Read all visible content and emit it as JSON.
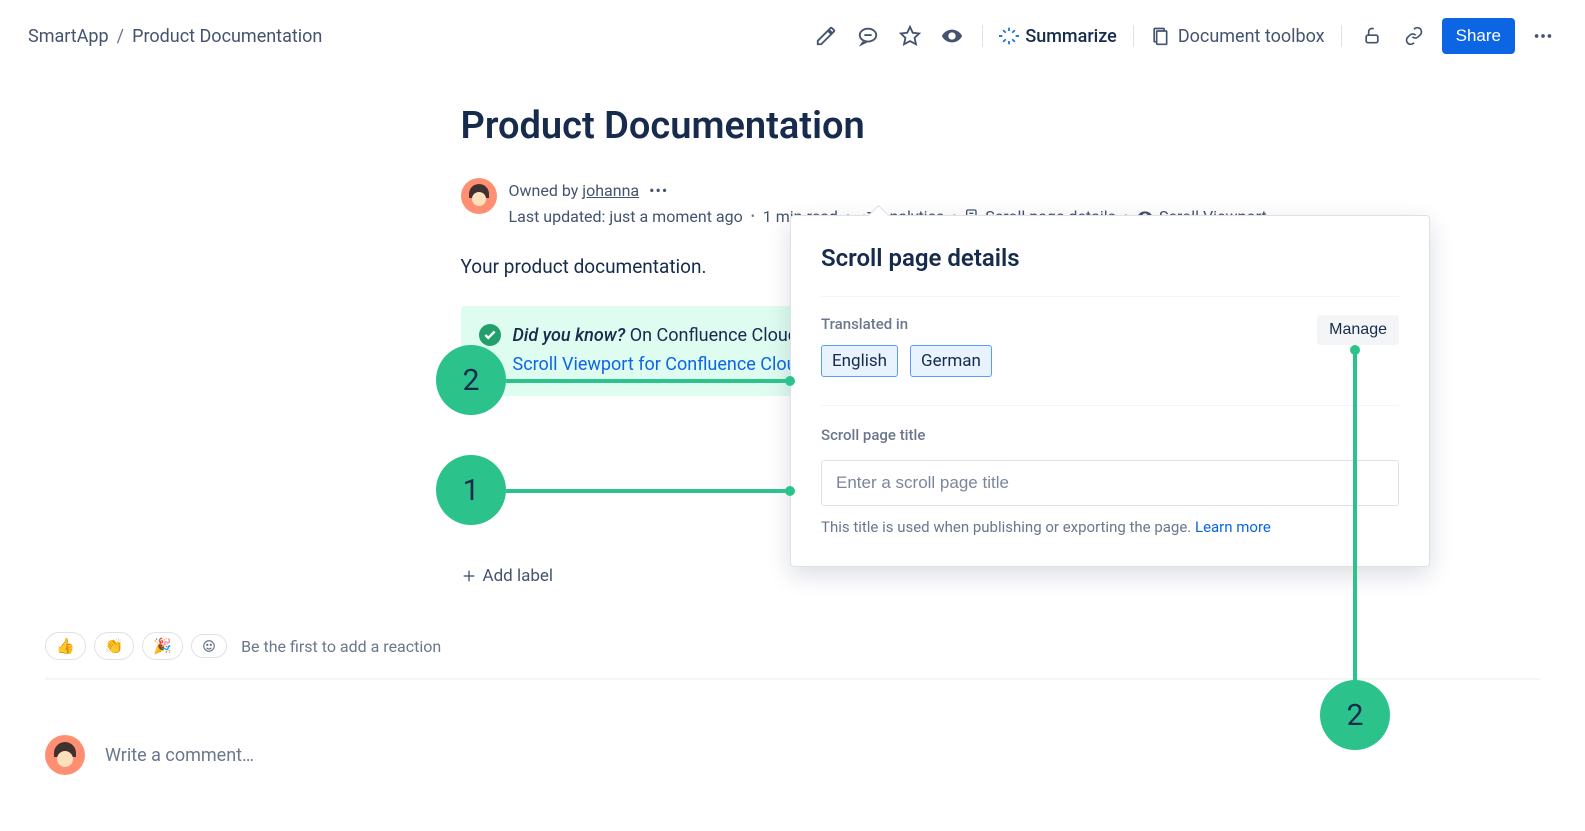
{
  "breadcrumb": {
    "space": "SmartApp",
    "page": "Product Documentation"
  },
  "toolbar": {
    "summarize": "Summarize",
    "toolbox": "Document toolbox",
    "share": "Share"
  },
  "page": {
    "title": "Product Documentation",
    "owned_by_prefix": "Owned by ",
    "owner": "johanna",
    "last_updated": "Last updated: just a moment ago",
    "read_time": "1 min read",
    "analytics": "Analytics",
    "scroll_details": "Scroll page details",
    "scroll_viewport": "Scroll Viewport",
    "body": "Your product documentation.",
    "panel": {
      "lead": "Did you know?",
      "text": " On Confluence Cloud, you can publish and style a help center from spaces with ",
      "link": "Scroll Viewport for Confluence Cloud",
      "tail": "."
    },
    "add_label": "Add label"
  },
  "popup": {
    "heading": "Scroll page details",
    "translated_label": "Translated in",
    "manage": "Manage",
    "languages": [
      "English",
      "German"
    ],
    "title_section_label": "Scroll page title",
    "title_placeholder": "Enter a scroll page title",
    "help_text": "This title is used when publishing or exporting the page. ",
    "learn_more": "Learn more"
  },
  "reactions": {
    "emojis": [
      "👍",
      "👏",
      "🎉"
    ],
    "add_icon": "😊",
    "hint": "Be the first to add a reaction"
  },
  "comment": {
    "placeholder": "Write a comment…"
  },
  "annotations": {
    "a1": "1",
    "a2": "2",
    "a3": "2"
  },
  "colors": {
    "accent": "#0C66E4",
    "callout": "#2BC38B",
    "panel": "#DFFCF0"
  }
}
